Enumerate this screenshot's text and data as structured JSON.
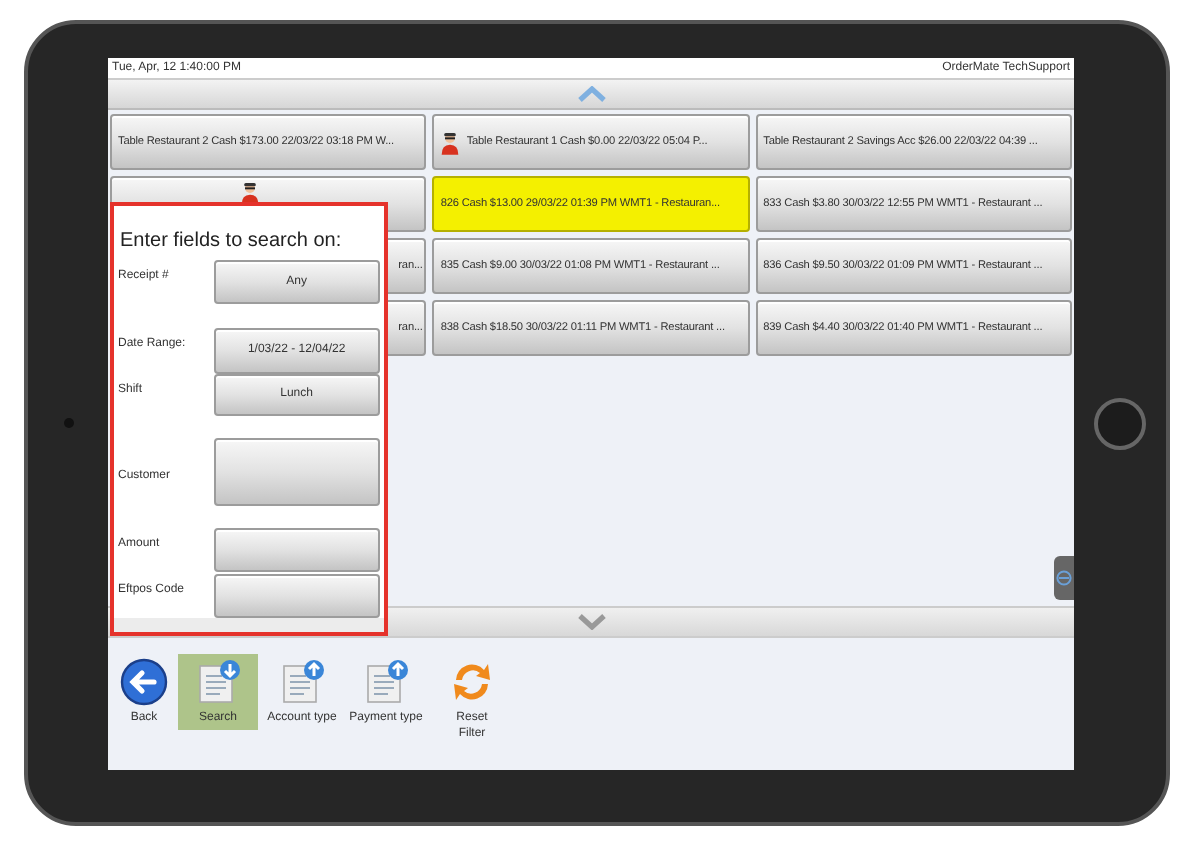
{
  "status_bar": {
    "datetime": "Tue, Apr, 12  1:40:00 PM",
    "user": "OrderMate TechSupport"
  },
  "transactions": [
    {
      "text": "Table Restaurant 2 Cash $173.00 22/03/22 03:18 PM W...",
      "kind": "plain",
      "selected": false
    },
    {
      "text": "Table Restaurant 1 Cash $0.00 22/03/22 05:04 P...",
      "kind": "person",
      "selected": false
    },
    {
      "text": "Table Restaurant 2 Savings Acc $26.00 22/03/22 04:39 ...",
      "kind": "plain",
      "selected": false
    },
    {
      "kind": "person_covered",
      "selected": false
    },
    {
      "text": "826 Cash $13.00 29/03/22 01:39 PM WMT1 - Restauran...",
      "kind": "plain",
      "selected": true
    },
    {
      "text": "833 Cash $3.80 30/03/22 12:55 PM WMT1 - Restaurant ...",
      "kind": "plain",
      "selected": false
    },
    {
      "text": "ran...",
      "kind": "covered",
      "selected": false
    },
    {
      "text": "835 Cash $9.00 30/03/22 01:08 PM WMT1 - Restaurant ...",
      "kind": "plain",
      "selected": false
    },
    {
      "text": "836 Cash $9.50 30/03/22 01:09 PM WMT1 - Restaurant ...",
      "kind": "plain",
      "selected": false
    },
    {
      "text": "ran...",
      "kind": "covered",
      "selected": false
    },
    {
      "text": "838 Cash $18.50 30/03/22 01:11 PM WMT1 - Restaurant ...",
      "kind": "plain",
      "selected": false
    },
    {
      "text": "839 Cash $4.40 30/03/22 01:40 PM WMT1 - Restaurant ...",
      "kind": "plain",
      "selected": false
    }
  ],
  "search_panel": {
    "title": "Enter fields to search on:",
    "fields": [
      {
        "label": "Receipt #",
        "value": "Any"
      },
      {
        "label": "Date Range:",
        "value": "1/03/22 - 12/04/22"
      },
      {
        "label": "Shift",
        "value": "Lunch"
      },
      {
        "label": "Customer"
      },
      {
        "label": "Amount"
      },
      {
        "label": "Eftpos Code"
      }
    ]
  },
  "toolbar": [
    {
      "label": "Back",
      "kind": "back",
      "selected": false
    },
    {
      "label": "Search",
      "kind": "doc_down",
      "selected": true
    },
    {
      "label": "Account type",
      "kind": "doc_up",
      "selected": false
    },
    {
      "label": "Payment type",
      "kind": "doc_up",
      "selected": false
    },
    {
      "label": "Reset Filter",
      "kind": "reset",
      "selected": false
    }
  ]
}
